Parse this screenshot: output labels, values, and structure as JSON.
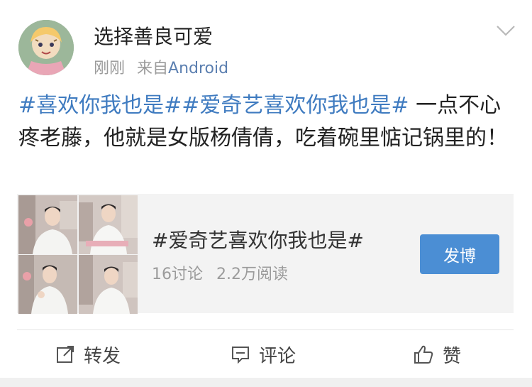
{
  "post": {
    "author": "选择善良可爱",
    "time": "刚刚",
    "source_prefix": "来自",
    "source": "Android",
    "tag1": "#喜欢你我也是#",
    "tag2": "#爱奇艺喜欢你我也是#",
    "text": " 一点不心疼老藤，他就是女版杨倩倩，吃着碗里惦记锅里的！"
  },
  "card": {
    "title": "#爱奇艺喜欢你我也是#",
    "discussions": "16讨论",
    "reads": "2.2万阅读",
    "button": "发博"
  },
  "actions": {
    "repost": "转发",
    "comment": "评论",
    "like": "赞"
  },
  "colors": {
    "accent": "#3f7bc0",
    "button": "#4b8ed4"
  }
}
